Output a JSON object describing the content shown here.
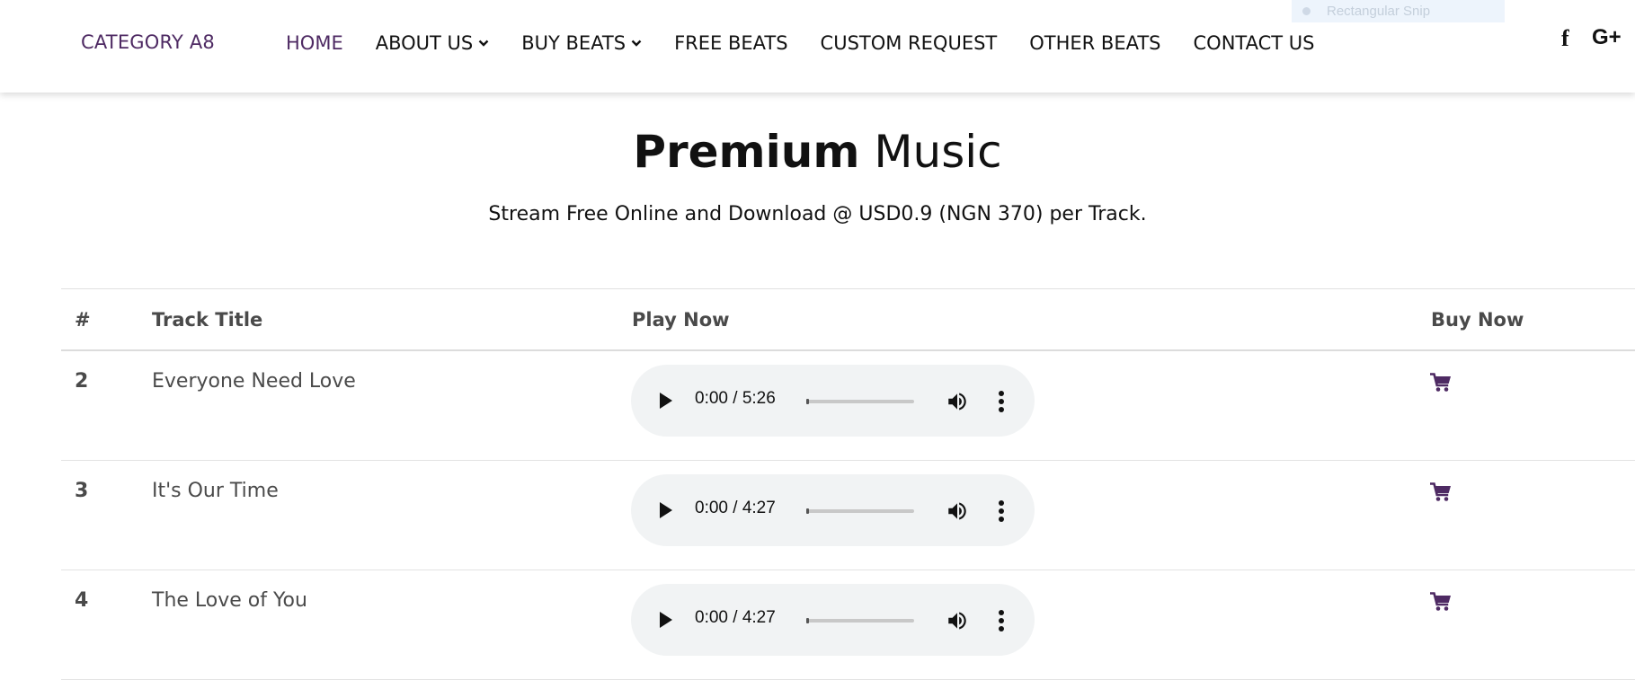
{
  "header": {
    "logo": "CATEGORY A8",
    "nav": [
      {
        "label": "HOME",
        "active": true,
        "dropdown": false
      },
      {
        "label": "ABOUT US",
        "active": false,
        "dropdown": true
      },
      {
        "label": "BUY BEATS",
        "active": false,
        "dropdown": true
      },
      {
        "label": "FREE BEATS",
        "active": false,
        "dropdown": false
      },
      {
        "label": "CUSTOM REQUEST",
        "active": false,
        "dropdown": false
      },
      {
        "label": "OTHER BEATS",
        "active": false,
        "dropdown": false
      },
      {
        "label": "CONTACT US",
        "active": false,
        "dropdown": false
      }
    ],
    "snip_overlay": "Rectangular Snip",
    "social": {
      "facebook": "f",
      "google_plus": "G+"
    }
  },
  "hero": {
    "title_bold": "Premium",
    "title_light": "Music",
    "subtitle": "Stream Free Online and Download @ USD0.9 (NGN 370) per Track."
  },
  "table": {
    "columns": {
      "num": "#",
      "title": "Track Title",
      "play": "Play Now",
      "buy": "Buy Now"
    },
    "rows": [
      {
        "num": "2",
        "title": "Everyone Need Love",
        "time": "0:00 / 5:26"
      },
      {
        "num": "3",
        "title": "It's Our Time",
        "time": "0:00 / 4:27"
      },
      {
        "num": "4",
        "title": "The Love of You",
        "time": "0:00 / 4:27"
      }
    ]
  },
  "colors": {
    "brand": "#4e2a63",
    "text": "#111111",
    "muted": "#4a4a4a",
    "player_bg": "#f1f3f4"
  },
  "icons": {
    "play": "play-icon",
    "volume": "volume-icon",
    "more": "more-vert-icon",
    "cart": "shopping-cart-icon",
    "chevron": "chevron-down-icon"
  }
}
